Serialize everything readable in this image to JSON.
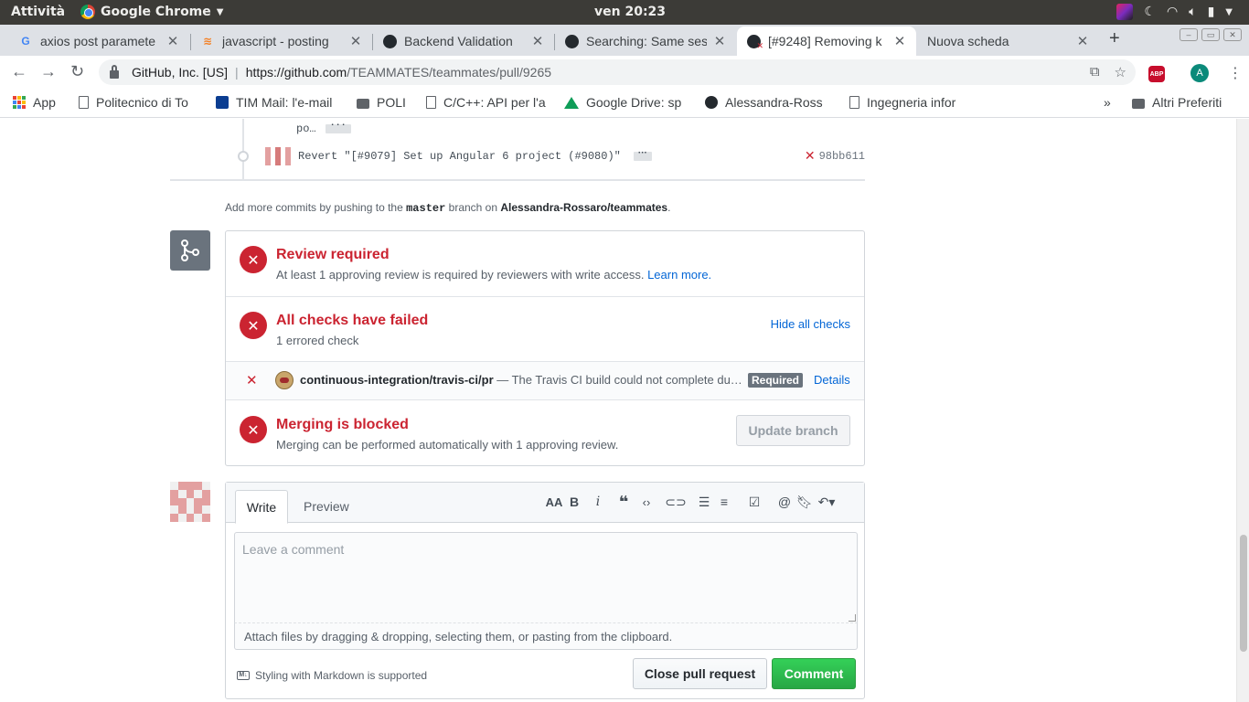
{
  "system": {
    "activities": "Attività",
    "app_name": "Google Chrome",
    "clock": "ven 20:23"
  },
  "tabs": [
    {
      "title": "axios post paramete",
      "favicon": "google-icon",
      "active": false
    },
    {
      "title": "javascript - posting",
      "favicon": "stackoverflow-icon",
      "active": false
    },
    {
      "title": "Backend Validation",
      "favicon": "github-icon",
      "active": false
    },
    {
      "title": "Searching: Same ses",
      "favicon": "github-icon",
      "active": false
    },
    {
      "title": "[#9248] Removing k",
      "favicon": "github-failed-icon",
      "active": true
    },
    {
      "title": "Nuova scheda",
      "favicon": "",
      "active": false
    }
  ],
  "address": {
    "org": "GitHub, Inc. [US]",
    "host": "https://github.com",
    "path": "/TEAMMATES/teammates/pull/9265",
    "abp": "ABP",
    "profile_initial": "A"
  },
  "bookmarks": [
    {
      "label": "App",
      "icon": "apps-icon"
    },
    {
      "label": "Politecnico di To",
      "icon": "page-icon"
    },
    {
      "label": "TIM Mail: l'e-mail",
      "icon": "mail-icon"
    },
    {
      "label": "POLI",
      "icon": "folder-icon"
    },
    {
      "label": "C/C++: API per l'a",
      "icon": "page-icon"
    },
    {
      "label": "Google Drive: sp",
      "icon": "drive-icon"
    },
    {
      "label": "Alessandra-Ross",
      "icon": "github-icon"
    },
    {
      "label": "Ingegneria infor",
      "icon": "page-icon"
    },
    {
      "label": "»",
      "icon": ""
    },
    {
      "label": "Altri Preferiti",
      "icon": "folder-icon"
    }
  ],
  "timeline": {
    "prev_commit_trunc": "po…",
    "commit_message": "Revert \"[#9079] Set up Angular 6 project (#9080)\"",
    "commit_sha": "98bb611",
    "ellipsis": "···",
    "add_more_prefix": "Add more commits by pushing to the ",
    "add_more_branch": "master",
    "add_more_mid": " branch on ",
    "add_more_repo": "Alessandra-Rossaro/teammates",
    "add_more_suffix": "."
  },
  "merge": {
    "review_title": "Review required",
    "review_sub": "At least 1 approving review is required by reviewers with write access.",
    "learn_more": "Learn more.",
    "checks_title": "All checks have failed",
    "checks_sub": "1 errored check",
    "hide_checks": "Hide all checks",
    "check_name": "continuous-integration/travis-ci/pr",
    "check_desc": " — The Travis CI build could not complete du…",
    "required_badge": "Required",
    "details_link": "Details",
    "blocked_title": "Merging is blocked",
    "blocked_sub": "Merging can be performed automatically with 1 approving review.",
    "update_branch": "Update branch"
  },
  "comment": {
    "tab_write": "Write",
    "tab_preview": "Preview",
    "placeholder": "Leave a comment",
    "attach_hint": "Attach files by dragging & dropping, selecting them, or pasting from the clipboard.",
    "markdown_note": "Styling with Markdown is supported",
    "close_pr": "Close pull request",
    "submit": "Comment"
  },
  "colors": {
    "fail_red": "#cb2431",
    "link_blue": "#0366d6",
    "success_green": "#28a745"
  }
}
